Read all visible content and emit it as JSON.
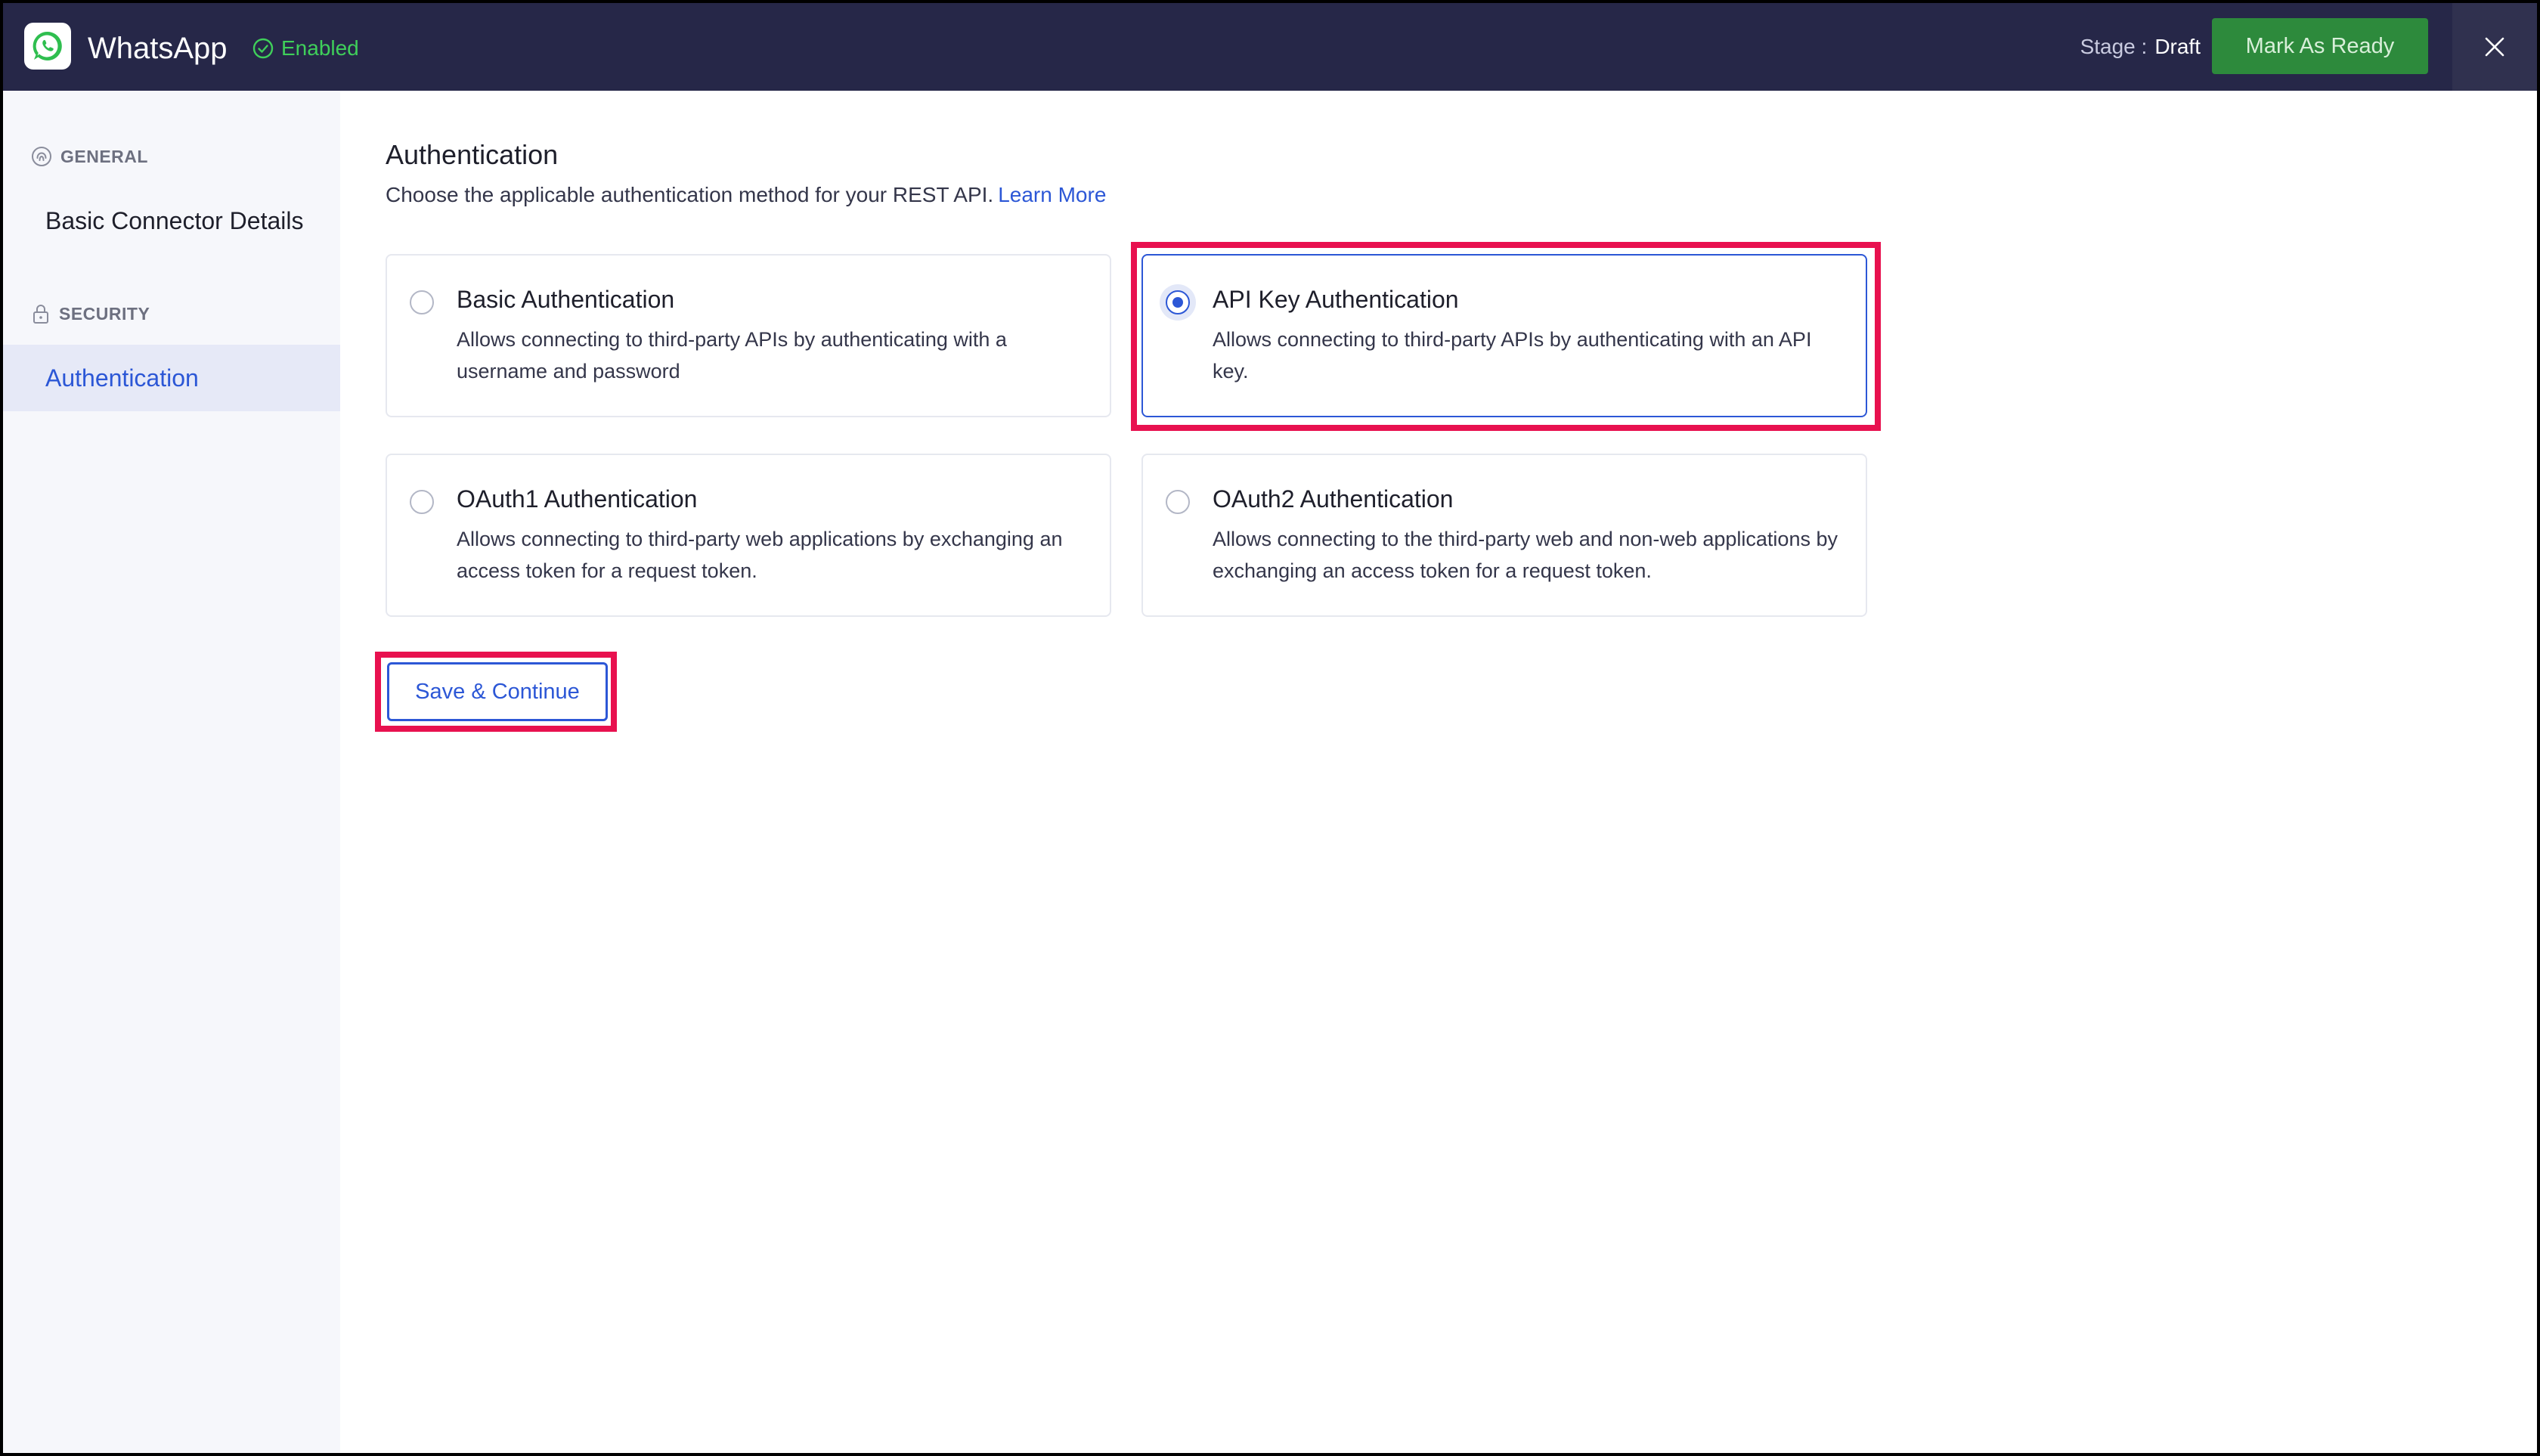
{
  "header": {
    "app_name": "WhatsApp",
    "status": "Enabled",
    "stage_label": "Stage :",
    "stage_value": "Draft",
    "mark_ready_label": "Mark As Ready",
    "colors": {
      "bar": "#262748",
      "status": "#3fcf5a",
      "ready_button": "#2d8a3c"
    }
  },
  "sidebar": {
    "sections": [
      {
        "label": "GENERAL",
        "icon": "fingerprint-icon",
        "items": [
          {
            "label": "Basic Connector Details",
            "active": false
          }
        ]
      },
      {
        "label": "SECURITY",
        "icon": "lock-icon",
        "items": [
          {
            "label": "Authentication",
            "active": true
          }
        ]
      }
    ]
  },
  "main": {
    "title": "Authentication",
    "description": "Choose the applicable authentication method for your REST API.",
    "learn_more": "Learn More",
    "options": [
      {
        "title": "Basic Authentication",
        "description": "Allows connecting to third-party APIs by authenticating with a username and password",
        "selected": false
      },
      {
        "title": "API Key Authentication",
        "description": "Allows connecting to third-party APIs by authenticating with an API key.",
        "selected": true
      },
      {
        "title": "OAuth1 Authentication",
        "description": "Allows connecting to third-party web applications by exchanging an access token for a request token.",
        "selected": false
      },
      {
        "title": "OAuth2 Authentication",
        "description": "Allows connecting to the third-party web and non-web applications by exchanging an access token for a request token.",
        "selected": false
      }
    ],
    "save_label": "Save & Continue",
    "accent_color": "#2c57d6",
    "highlight_color": "#e8114f"
  }
}
